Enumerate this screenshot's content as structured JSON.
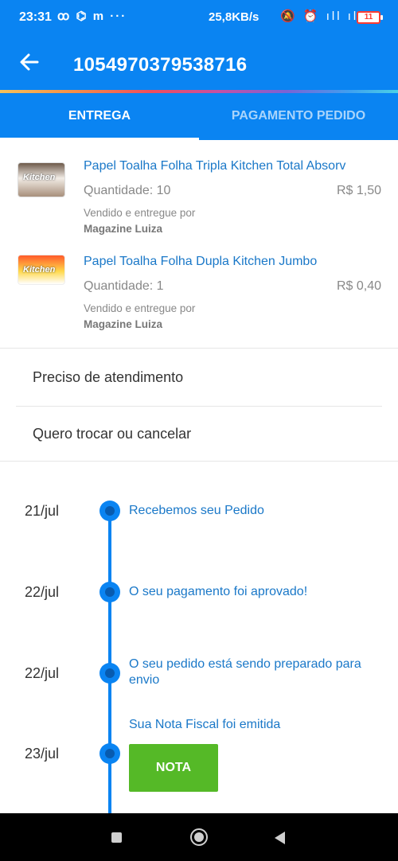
{
  "status_bar": {
    "time": "23:31",
    "left_icons": "ꝏ ⌬ m ···",
    "network_speed": "25,8KB/s",
    "right_icons": "🔕 ⏰ ıll ıll ◠",
    "battery": "11"
  },
  "header": {
    "order_number": "1054970379538716"
  },
  "tabs": [
    {
      "label": "ENTREGA",
      "active": true
    },
    {
      "label": "PAGAMENTO PEDIDO",
      "active": false
    }
  ],
  "products": [
    {
      "name": "Papel Toalha Folha Tripla Kitchen Total Absorv",
      "quantity": "Quantidade: 10",
      "price": "R$ 1,50",
      "seller_label": "Vendido e entregue por",
      "seller": "Magazine Luiza",
      "thumb_text": "Kitchen"
    },
    {
      "name": "Papel Toalha Folha Dupla Kitchen Jumbo",
      "quantity": "Quantidade: 1",
      "price": "R$ 0,40",
      "seller_label": "Vendido e entregue por",
      "seller": "Magazine Luiza",
      "thumb_text": "Kitchen"
    }
  ],
  "menu": [
    {
      "label": "Preciso de atendimento"
    },
    {
      "label": "Quero trocar ou cancelar"
    }
  ],
  "timeline": [
    {
      "date": "21/jul",
      "text": "Recebemos seu Pedido"
    },
    {
      "date": "22/jul",
      "text": "O seu pagamento foi aprovado!"
    },
    {
      "date": "22/jul",
      "text": "O seu pedido está sendo preparado para envio"
    },
    {
      "date": "23/jul",
      "text": "Sua Nota Fiscal foi emitida",
      "button": "NOTA"
    }
  ],
  "colors": {
    "primary": "#0A84F2",
    "link": "#1a78c8",
    "nota_button": "#55b927"
  }
}
